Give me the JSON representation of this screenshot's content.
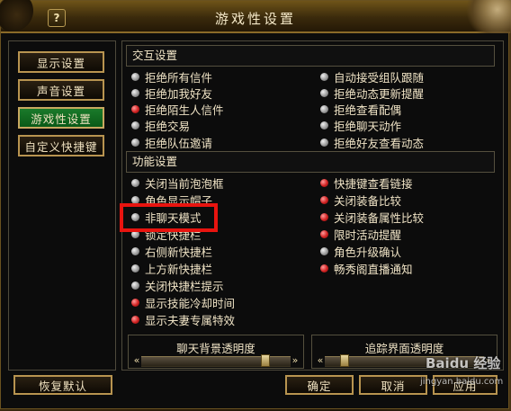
{
  "window": {
    "title": "游戏性设置",
    "help_label": "?"
  },
  "nav": {
    "items": [
      {
        "label": "显示设置",
        "active": false
      },
      {
        "label": "声音设置",
        "active": false
      },
      {
        "label": "游戏性设置",
        "active": true
      },
      {
        "label": "自定义快捷键",
        "active": false
      }
    ]
  },
  "interaction": {
    "title": "交互设置",
    "left": [
      {
        "label": "拒绝所有信件",
        "checked": false
      },
      {
        "label": "拒绝加我好友",
        "checked": false
      },
      {
        "label": "拒绝陌生人信件",
        "checked": true
      },
      {
        "label": "拒绝交易",
        "checked": false
      },
      {
        "label": "拒绝队伍邀请",
        "checked": false
      }
    ],
    "right": [
      {
        "label": "自动接受组队跟随",
        "checked": false
      },
      {
        "label": "拒绝动态更新提醒",
        "checked": false
      },
      {
        "label": "拒绝查看配偶",
        "checked": false
      },
      {
        "label": "拒绝聊天动作",
        "checked": false
      },
      {
        "label": "拒绝好友查看动态",
        "checked": false
      }
    ]
  },
  "function": {
    "title": "功能设置",
    "left": [
      {
        "label": "关闭当前泡泡框",
        "checked": false
      },
      {
        "label": "角色显示帽子",
        "checked": false
      },
      {
        "label": "非聊天模式",
        "checked": false
      },
      {
        "label": "锁定快捷栏",
        "checked": false
      },
      {
        "label": "右侧新快捷栏",
        "checked": false
      },
      {
        "label": "上方新快捷栏",
        "checked": false
      },
      {
        "label": "关闭快捷栏提示",
        "checked": false
      },
      {
        "label": "显示技能冷却时间",
        "checked": true
      },
      {
        "label": "显示夫妻专属特效",
        "checked": true
      }
    ],
    "right": [
      {
        "label": "快捷键查看链接",
        "checked": true
      },
      {
        "label": "关闭装备比较",
        "checked": true
      },
      {
        "label": "关闭装备属性比较",
        "checked": true
      },
      {
        "label": "限时活动提醒",
        "checked": true
      },
      {
        "label": "角色升级确认",
        "checked": false
      },
      {
        "label": "畅秀阁直播通知",
        "checked": true
      }
    ]
  },
  "sliders": {
    "chat_bg": {
      "label": "聊天背景透明度",
      "value": 0.85
    },
    "tracking": {
      "label": "追踪界面透明度",
      "value": 0.1
    }
  },
  "buttons": {
    "restore": "恢复默认",
    "ok": "确定",
    "cancel": "取消",
    "apply": "应用"
  },
  "watermark": {
    "text": "Baidu 经验",
    "url": "jingyan.baidu.com"
  },
  "colors": {
    "accent_gold": "#b89450",
    "active_green": "#1a7a2a",
    "radio_on": "#d02020",
    "highlight": "#e8140f"
  }
}
